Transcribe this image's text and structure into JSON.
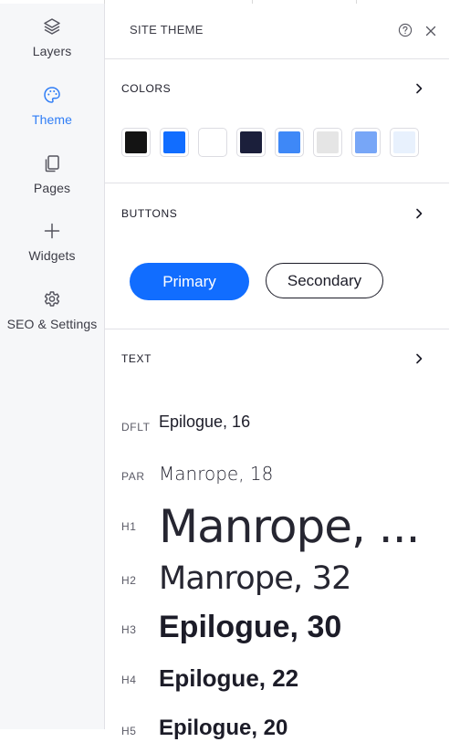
{
  "rail": {
    "items": [
      {
        "label": "Layers",
        "icon": "layers-icon"
      },
      {
        "label": "Theme",
        "icon": "palette-icon",
        "active": true
      },
      {
        "label": "Pages",
        "icon": "pages-icon"
      },
      {
        "label": "Widgets",
        "icon": "plus-icon"
      },
      {
        "label": "SEO & Settings",
        "icon": "gear-icon"
      }
    ],
    "active_color": "#2f7df6"
  },
  "panel": {
    "title": "SITE THEME",
    "help_icon": "question-circle-icon",
    "close_icon": "close-icon"
  },
  "colors": {
    "label": "COLORS",
    "swatches": [
      "#141414",
      "#116dff",
      "#ffffff",
      "#1b1f3b",
      "#3e88f7",
      "#e5e5e5",
      "#77a6f7",
      "#e8f1fd"
    ]
  },
  "buttons": {
    "label": "BUTTONS",
    "primary_label": "Primary",
    "secondary_label": "Secondary",
    "primary_color": "#116dff"
  },
  "text": {
    "label": "TEXT",
    "styles": [
      {
        "tag": "DFLT",
        "sample": "Epilogue, 16"
      },
      {
        "tag": "PAR",
        "sample": "Manrope, 18"
      },
      {
        "tag": "H1",
        "sample": "Manrope, ..."
      },
      {
        "tag": "H2",
        "sample": "Manrope, 32"
      },
      {
        "tag": "H3",
        "sample": "Epilogue, 30"
      },
      {
        "tag": "H4",
        "sample": "Epilogue, 22"
      },
      {
        "tag": "H5",
        "sample": "Epilogue, 20"
      }
    ]
  }
}
